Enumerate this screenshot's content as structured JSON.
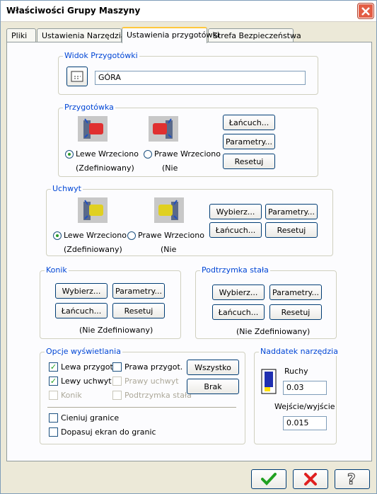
{
  "window": {
    "title": "Właściwości Grupy Maszyny"
  },
  "tabs": [
    {
      "label": "Pliki"
    },
    {
      "label": "Ustawienia Narzędzia"
    },
    {
      "label": "Ustawienia przygotówki"
    },
    {
      "label": "Strefa Bezpieczeństwa"
    }
  ],
  "widok": {
    "title": "Widok Przygotówki",
    "value": "GÓRA"
  },
  "przygotowka": {
    "title": "Przygotówka",
    "left_radio": "Lewe Wrzeciono",
    "left_sub": "(Zdefiniowany)",
    "right_radio": "Prawe Wrzeciono",
    "right_sub": "(Nie",
    "btn_chain": "Łańcuch...",
    "btn_params": "Parametry...",
    "btn_reset": "Resetuj"
  },
  "uchwyt": {
    "title": "Uchwyt",
    "left_radio": "Lewe Wrzeciono",
    "left_sub": "(Zdefiniowany)",
    "right_radio": "Prawe Wrzeciono",
    "right_sub": "(Nie",
    "btn_select": "Wybierz...",
    "btn_params": "Parametry...",
    "btn_chain": "Łańcuch...",
    "btn_reset": "Resetuj"
  },
  "konik": {
    "title": "Konik",
    "btn_select": "Wybierz...",
    "btn_params": "Parametry...",
    "btn_chain": "Łańcuch...",
    "btn_reset": "Resetuj",
    "status": "(Nie Zdefiniowany)"
  },
  "podtrzymka": {
    "title": "Podtrzymka stała",
    "btn_select": "Wybierz...",
    "btn_params": "Parametry...",
    "btn_chain": "Łańcuch...",
    "btn_reset": "Resetuj",
    "status": "(Nie Zdefiniowany)"
  },
  "opcje": {
    "title": "Opcje wyświetlania",
    "lewa_przygot": "Lewa przygot.",
    "prawa_przygot": "Prawa przygot.",
    "lewy_uchwyt": "Lewy uchwyt",
    "prawy_uchwyt": "Prawy uchwyt",
    "konik": "Konik",
    "podtrzymka": "Podtrzymka stała",
    "btn_all": "Wszystko",
    "btn_none": "Brak",
    "cieniuj": "Cieniuj granice",
    "dopasuj": "Dopasuj ekran do granic"
  },
  "naddatek": {
    "title": "Naddatek narzędzia",
    "ruchy_label": "Ruchy",
    "ruchy_value": "0.03",
    "wejscie_label": "Wejście/wyjście",
    "wejscie_value": "0.015"
  },
  "colors": {
    "accent": "#0046d5",
    "ok": "#21a121",
    "cancel": "#e02020",
    "chuck_left": "#e03030",
    "chuck_yellow": "#e0d020"
  }
}
